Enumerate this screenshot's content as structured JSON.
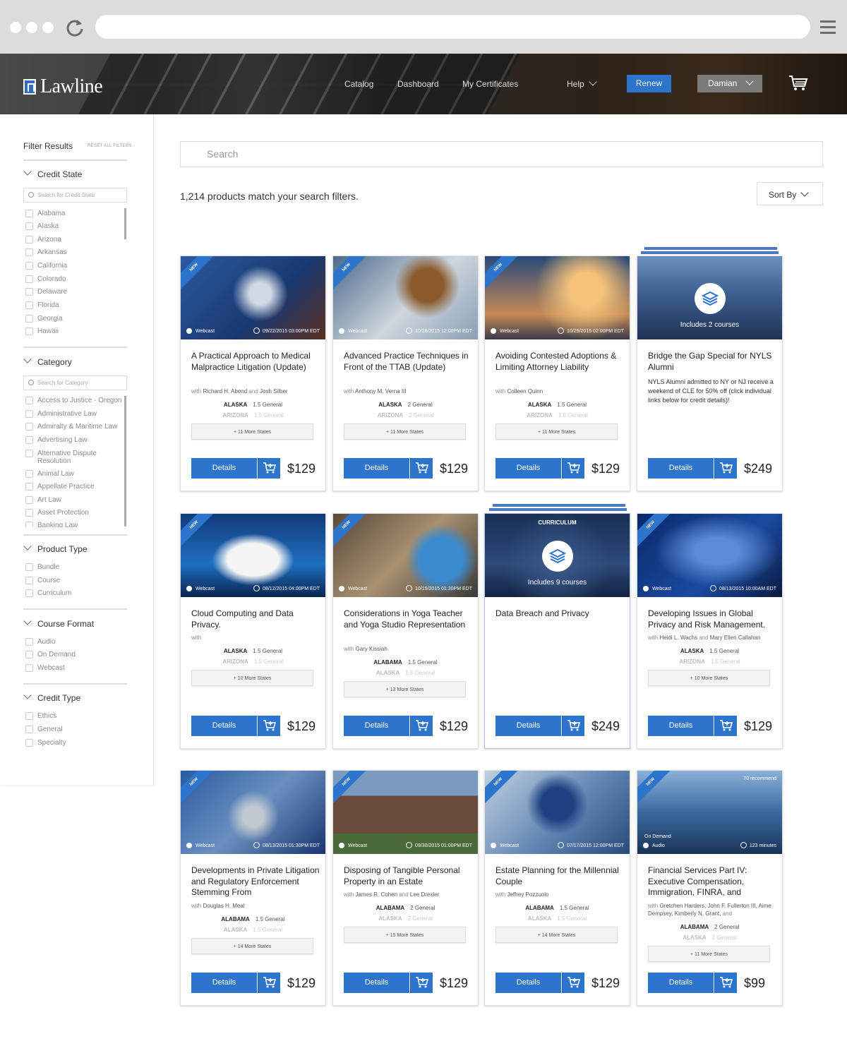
{
  "header": {
    "logo": "Lawline",
    "nav": [
      "Catalog",
      "Dashboard",
      "My Certificates",
      "Help"
    ],
    "renew": "Renew",
    "user": "Damian"
  },
  "sidebar": {
    "title": "Filter Results",
    "reset": "RESET ALL FILTERS",
    "credit_state": {
      "label": "Credit State",
      "placeholder": "Search for Credit State",
      "items": [
        "Alabama",
        "Alaska",
        "Arizona",
        "Arkansas",
        "California",
        "Colorado",
        "Delaware",
        "Florida",
        "Georgia",
        "Hawaii"
      ]
    },
    "category": {
      "label": "Category",
      "placeholder": "Search for Category",
      "items": [
        "Access to Justice - Oregon",
        "Administrative Law",
        "Admiralty & Maritime Law",
        "Advertising Law",
        "Alternative Dispute Resolution",
        "Animal Law",
        "Appellate Practice",
        "Art Law",
        "Asset Protection",
        "Banking Law"
      ]
    },
    "product_type": {
      "label": "Product Type",
      "items": [
        "Bundle",
        "Course",
        "Curriculum"
      ]
    },
    "course_format": {
      "label": "Course Format",
      "items": [
        "Audio",
        "On Demand",
        "Webcast"
      ]
    },
    "credit_type": {
      "label": "Credit Type",
      "items": [
        "Ethics",
        "General",
        "Specialty"
      ]
    }
  },
  "search": {
    "placeholder": "Search"
  },
  "results": {
    "count": "1,214 products match your search filters.",
    "sort": "Sort By"
  },
  "card_ui": {
    "new": "NEW",
    "details": "Details"
  },
  "cards": [
    {
      "title": "A Practical Approach to Medical Malpractice Litigation (Update)",
      "with": "with",
      "p1": "Richard H. Abend",
      "and": "and",
      "p2": "Josh Silber",
      "fmt": "Webcast",
      "date": "09/22/2015 03:00PM EDT",
      "s1": "ALASKA",
      "c1": "1.5 General",
      "s2": "ARIZONA",
      "c2": "1.5 General",
      "more": "+ 11 More States",
      "price": "$129"
    },
    {
      "title": "Advanced Practice Techniques in Front of the TTAB (Update)",
      "with": "with",
      "p1": "Anthony M. Verna III",
      "fmt": "Webcast",
      "date": "10/28/2015 12:00PM EDT",
      "s1": "ALASKA",
      "c1": "2 General",
      "s2": "ARIZONA",
      "c2": "2 General",
      "more": "+ 11 More States",
      "price": "$129"
    },
    {
      "title": "Avoiding Contested Adoptions & Limiting Attorney Liability",
      "with": "with",
      "p1": "Colleen Quinn",
      "fmt": "Webcast",
      "date": "10/29/2015 02:00PM EDT",
      "s1": "ALASKA",
      "c1": "1.5 General",
      "s2": "ARIZONA",
      "c2": "1.5 General",
      "more": "+ 11 More States",
      "price": "$129"
    },
    {
      "title": "Bridge the Gap Special for NYLS Alumni",
      "desc": "NYLS Alumni admitted to NY or NJ receive a weekend of CLE for 50% off (click individual links below for credit details)!",
      "includes": "Includes 2 courses",
      "price": "$249"
    },
    {
      "title": "Cloud Computing and Data Privacy.",
      "with": "with",
      "fmt": "Webcast",
      "date": "08/12/2015 04:00PM EDT",
      "s1": "ALASKA",
      "c1": "1.5 General",
      "s2": "ARIZONA",
      "c2": "1.5 General",
      "more": "+ 10 More States",
      "price": "$129"
    },
    {
      "title": "Considerations in Yoga Teacher and Yoga Studio Representation",
      "with": "with",
      "p1": "Gary Kissiah",
      "fmt": "Webcast",
      "date": "10/15/2015 01:30PM EDT",
      "s1": "ALABAMA",
      "c1": "1.5 General",
      "s2": "ALASKA",
      "c2": "1.5 General",
      "more": "+ 13 More States",
      "price": "$129"
    },
    {
      "title": "Data Breach and Privacy",
      "badge": "CURRICULUM",
      "includes": "Includes 9 courses",
      "price": "$249"
    },
    {
      "title": "Developing Issues in Global Privacy and Risk Management.",
      "with": "with",
      "p1": "Heidi L. Wachs",
      "and": "and",
      "p2": "Mary Ellen Callahan",
      "fmt": "Webcast",
      "date": "08/13/2015 10:00AM EDT",
      "s1": "ALASKA",
      "c1": "1.5 General",
      "s2": "ARIZONA",
      "c2": "1.5 General",
      "more": "+ 10 More States",
      "price": "$129"
    },
    {
      "title": "Developments in Private Litigation and Regulatory Enforcement Stemming From",
      "with": "with",
      "p1": "Douglas H. Meal",
      "fmt": "Webcast",
      "date": "08/13/2015 01:30PM EDT",
      "s1": "ALABAMA",
      "c1": "1.5 General",
      "s2": "ALASKA",
      "c2": "1.5 General",
      "more": "+ 14 More States",
      "price": "$129"
    },
    {
      "title": "Disposing of Tangible Personal Property in an Estate",
      "with": "with",
      "p1": "James R. Cohen",
      "and": "and",
      "p2": "Lee Drexler",
      "fmt": "Webcast",
      "date": "09/30/2015 01:00PM EDT",
      "s1": "ALABAMA",
      "c1": "2 General",
      "s2": "ALASKA",
      "c2": "2 General",
      "more": "+ 15 More States",
      "price": "$129"
    },
    {
      "title": "Estate Planning for the Millennial Couple",
      "with": "with",
      "p1": "Jeffrey Pozzuolo",
      "fmt": "Webcast",
      "date": "07/17/2015 12:00PM EDT",
      "s1": "ALABAMA",
      "c1": "1.5 General",
      "s2": "ALASKA",
      "c2": "1.5 General",
      "more": "+ 14 More States",
      "price": "$129"
    },
    {
      "title": "Financial Services Part IV: Executive Compensation, Immigration, FINRA, and",
      "with": "with",
      "p1": "Gretchen Harders, John F. Fullerton III, Aime Dempsey, Kimberly N. Grant,",
      "and": "and",
      "fmt": "Audio",
      "fmt2": "On Demand",
      "date": "123 minutes",
      "rec": "70 recommend",
      "s1": "ALABAMA",
      "c1": "2 General",
      "s2": "ALASKA",
      "c2": "2 General",
      "more": "+ 11 More States",
      "price": "$99"
    }
  ]
}
